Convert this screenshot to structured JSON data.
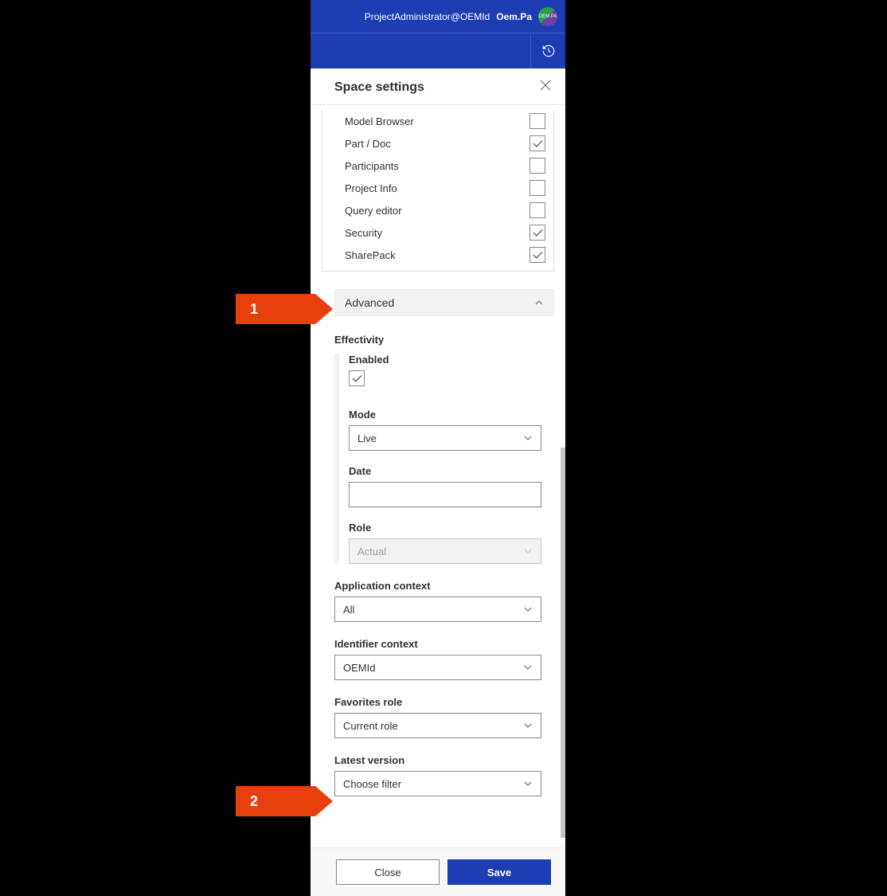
{
  "header": {
    "user_email": "ProjectAdministrator@OEMId",
    "org_name": "Oem.Pa",
    "avatar_text": "OEM PA"
  },
  "panel": {
    "title": "Space settings"
  },
  "checklist": [
    {
      "label": "Model Browser",
      "checked": false
    },
    {
      "label": "Part / Doc",
      "checked": true
    },
    {
      "label": "Participants",
      "checked": false
    },
    {
      "label": "Project Info",
      "checked": false
    },
    {
      "label": "Query editor",
      "checked": false
    },
    {
      "label": "Security",
      "checked": true
    },
    {
      "label": "SharePack",
      "checked": true
    }
  ],
  "advanced_section": {
    "title": "Advanced"
  },
  "effectivity": {
    "title": "Effectivity",
    "enabled_label": "Enabled",
    "enabled_checked": true,
    "mode_label": "Mode",
    "mode_value": "Live",
    "date_label": "Date",
    "date_value": "",
    "role_label": "Role",
    "role_value": "Actual"
  },
  "app_context": {
    "label": "Application context",
    "value": "All"
  },
  "id_context": {
    "label": "Identifier context",
    "value": "OEMId"
  },
  "fav_role": {
    "label": "Favorites role",
    "value": "Current role"
  },
  "latest_version": {
    "label": "Latest version",
    "value": "Choose filter"
  },
  "footer": {
    "close": "Close",
    "save": "Save"
  },
  "callouts": {
    "c1": "1",
    "c2": "2"
  }
}
